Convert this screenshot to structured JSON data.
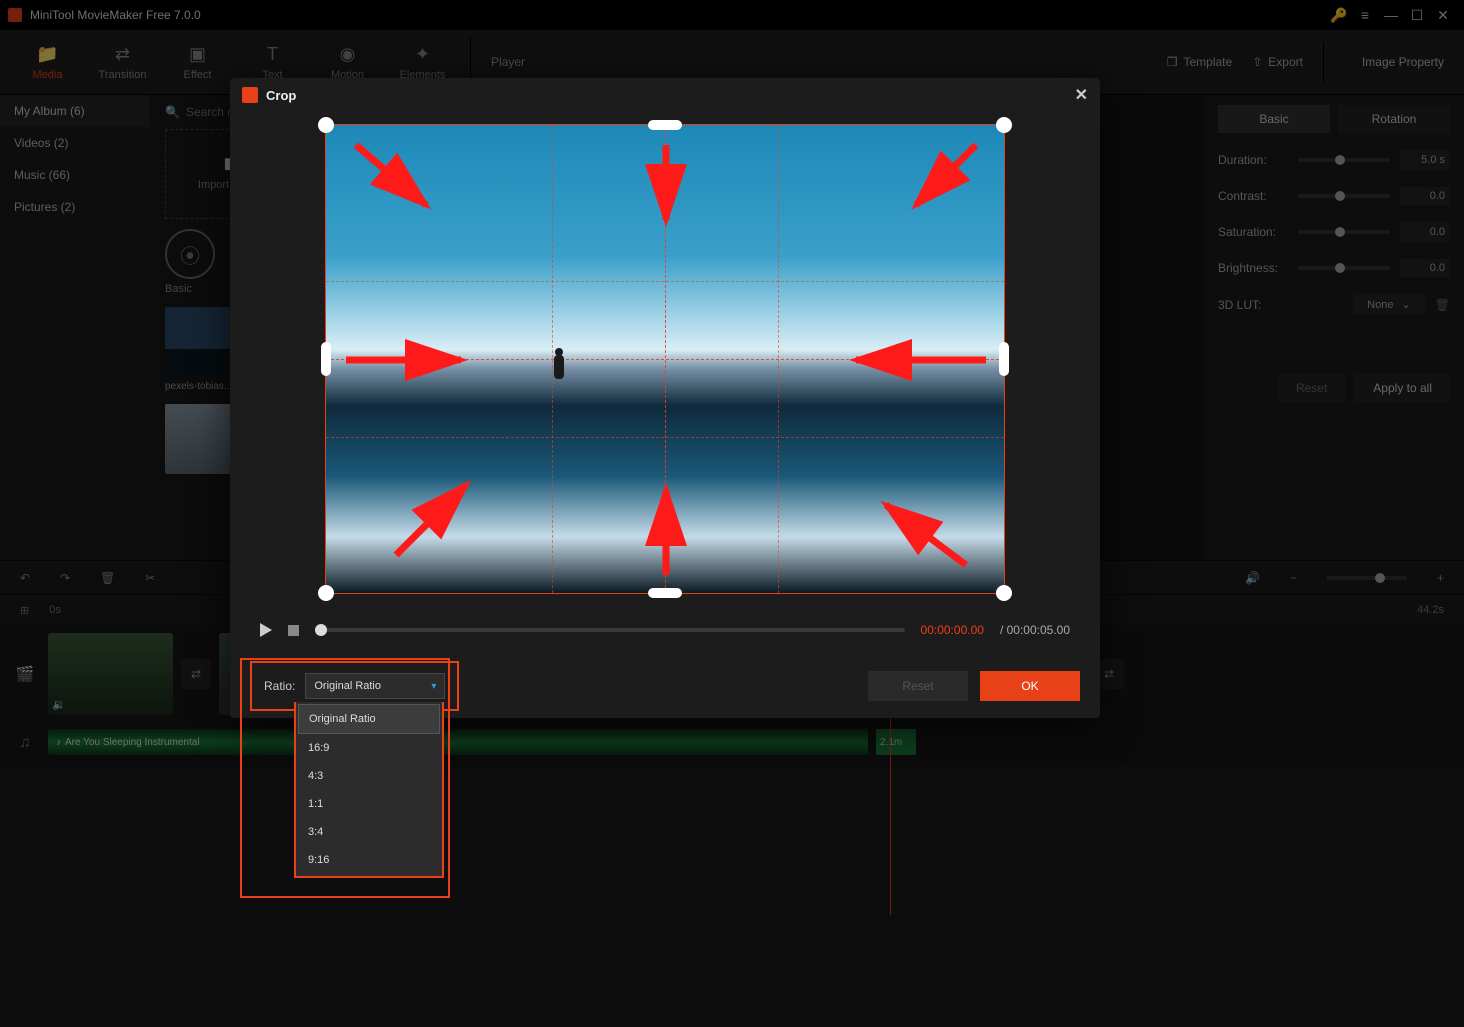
{
  "titlebar": {
    "title": "MiniTool MovieMaker Free 7.0.0"
  },
  "mainTabs": {
    "media": "Media",
    "transition": "Transition",
    "effect": "Effect",
    "text": "Text",
    "motion": "Motion",
    "elements": "Elements"
  },
  "topRight": {
    "player": "Player",
    "template": "Template",
    "export": "Export",
    "imageProperty": "Image Property"
  },
  "sidebar": {
    "header": "My Album (6)",
    "items": [
      "Videos (2)",
      "Music (66)",
      "Pictures (2)"
    ]
  },
  "mediaPanel": {
    "searchPlaceholder": "Search media",
    "import": "Import Media",
    "basic": "Basic",
    "thumbLabel": "pexels-tobias..."
  },
  "props": {
    "tabs": {
      "basic": "Basic",
      "rotation": "Rotation"
    },
    "duration": {
      "label": "Duration:",
      "value": "5.0 s"
    },
    "contrast": {
      "label": "Contrast:",
      "value": "0.0"
    },
    "saturation": {
      "label": "Saturation:",
      "value": "0.0"
    },
    "brightness": {
      "label": "Brightness:",
      "value": "0.0"
    },
    "lut": {
      "label": "3D LUT:",
      "value": "None"
    },
    "reset": "Reset",
    "apply": "Apply to all"
  },
  "timeline": {
    "start": "0s",
    "duration": "44.2s",
    "audioLabel": "Are You Sleeping Instrumental",
    "audioSeg2": "2.1m"
  },
  "modal": {
    "title": "Crop",
    "curTime": "00:00:00.00",
    "totTime": "/ 00:00:05.00",
    "ratioLabel": "Ratio:",
    "ratioValue": "Original Ratio",
    "reset": "Reset",
    "ok": "OK",
    "options": [
      "Original Ratio",
      "16:9",
      "4:3",
      "1:1",
      "3:4",
      "9:16"
    ]
  }
}
